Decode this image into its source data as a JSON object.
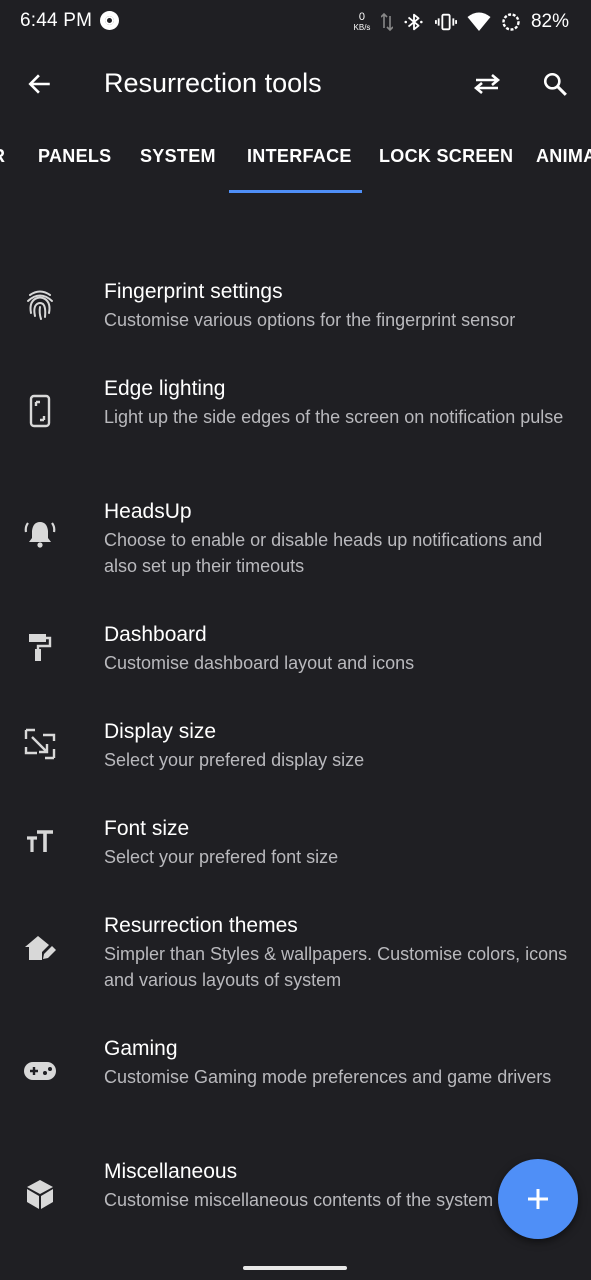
{
  "status_bar": {
    "time": "6:44 PM",
    "net_speed_value": "0",
    "net_speed_unit": "KB/s",
    "battery": "82%"
  },
  "app_bar": {
    "title": "Resurrection tools"
  },
  "tabs": [
    {
      "label": "R"
    },
    {
      "label": "PANELS"
    },
    {
      "label": "SYSTEM"
    },
    {
      "label": "INTERFACE",
      "selected": true
    },
    {
      "label": "LOCK SCREEN"
    },
    {
      "label": "ANIMA"
    }
  ],
  "items": [
    {
      "title": "Fingerprint settings",
      "subtitle": "Customise various options for the fingerprint sensor",
      "icon": "fingerprint-icon"
    },
    {
      "title": "Edge lighting",
      "subtitle": "Light up the side edges of the screen on notification pulse",
      "icon": "phone-edge-icon"
    },
    {
      "title": "HeadsUp",
      "subtitle": "Choose to enable or disable heads up notifications and also set up their timeouts",
      "icon": "bell-ring-icon"
    },
    {
      "title": "Dashboard",
      "subtitle": "Customise dashboard layout and icons",
      "icon": "paint-roller-icon"
    },
    {
      "title": "Display size",
      "subtitle": "Select your prefered display size",
      "icon": "resize-icon"
    },
    {
      "title": "Font size",
      "subtitle": "Select your prefered font size",
      "icon": "font-size-icon"
    },
    {
      "title": "Resurrection themes",
      "subtitle": "Simpler than Styles & wallpapers. Customise colors, icons and various layouts of system",
      "icon": "home-edit-icon"
    },
    {
      "title": "Gaming",
      "subtitle": "Customise Gaming mode preferences and game drivers",
      "icon": "gamepad-icon"
    },
    {
      "title": "Miscellaneous",
      "subtitle": "Customise miscellaneous contents of the system interface",
      "icon": "cube-icon"
    }
  ],
  "colors": {
    "background": "#1f1f23",
    "accent": "#4f8ff7",
    "subtitle": "#b9b9bd"
  }
}
